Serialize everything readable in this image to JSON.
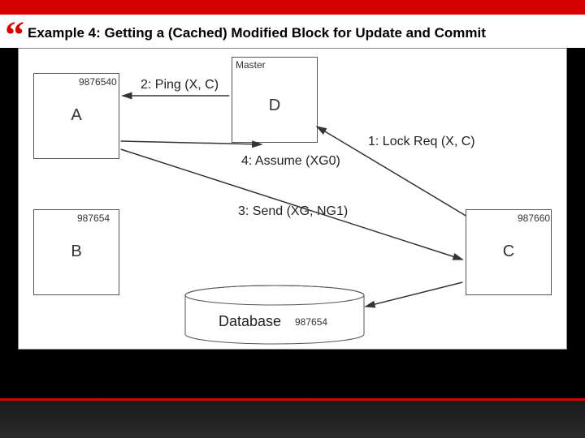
{
  "slide": {
    "title": "Example 4: Getting a (Cached) Modified Block for Update and Commit"
  },
  "nodes": {
    "a": {
      "label": "A",
      "scn": "9876540"
    },
    "b": {
      "label": "B",
      "scn": "987654"
    },
    "c": {
      "label": "C",
      "scn": "987660"
    },
    "d": {
      "label": "D",
      "role": "Master"
    }
  },
  "database": {
    "label": "Database",
    "scn": "987654"
  },
  "messages": {
    "m1": "1: Lock Req (X, C)",
    "m2": "2: Ping (X, C)",
    "m3": "3: Send (XG, NG1)",
    "m4": "4: Assume (XG0)"
  }
}
